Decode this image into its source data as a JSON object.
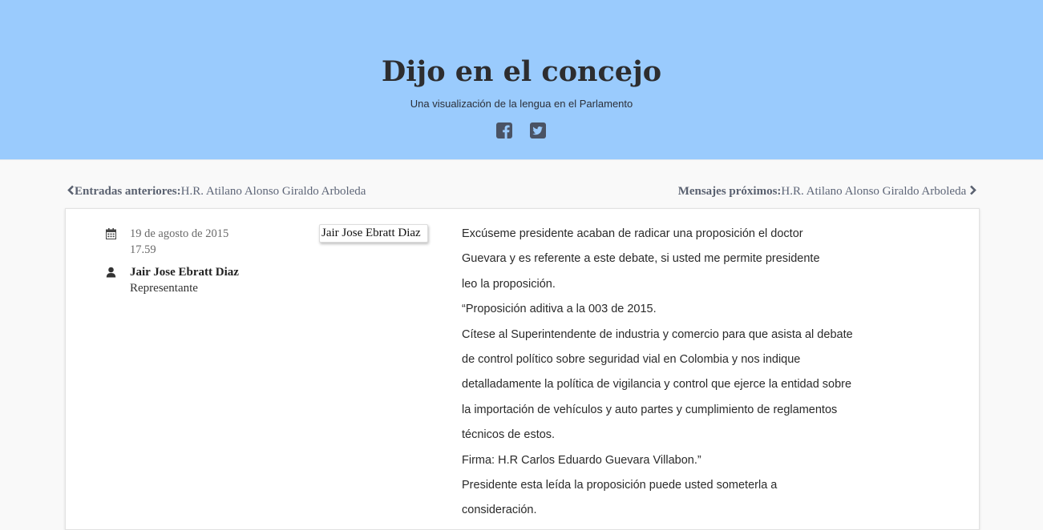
{
  "header": {
    "title": "Dijo en el concejo",
    "subtitle": "Una visualización de la lengua en el Parlamento",
    "social": [
      {
        "icon": "facebook-icon"
      },
      {
        "icon": "twitter-icon"
      }
    ]
  },
  "nav": {
    "prev_label": "Entradas anteriores:",
    "prev_name": "H.R. Atilano Alonso Giraldo Arboleda",
    "next_label": "Mensajes próximos:",
    "next_name": "H.R. Atilano Alonso Giraldo Arboleda"
  },
  "entry": {
    "date": "19 de agosto de 2015",
    "time": "17.59",
    "speaker_name": "Jair Jose Ebratt Diaz",
    "speaker_role": "Representante",
    "speaker_tag": "Jair Jose Ebratt Diaz",
    "lines": [
      "Excúseme presidente acaban de radicar una proposición el doctor",
      "Guevara y es referente a este debate, si usted me permite presidente",
      "leo la proposición.",
      "“Proposición aditiva a la 003 de 2015.",
      "Cítese al Superintendente de industria y comercio para que asista al debate",
      "de control político sobre seguridad vial en Colombia y nos indique",
      "detalladamente la política de vigilancia y control que ejerce la entidad sobre",
      "la importación de vehículos y auto partes y cumplimiento de reglamentos",
      "técnicos de estos.",
      "Firma: H.R Carlos Eduardo Guevara Villabon.”",
      "Presidente esta leída la proposición puede usted someterla a",
      "consideración."
    ]
  },
  "colors": {
    "header_bg": "#9acbfd",
    "page_bg": "#f9f9f9",
    "icon_color": "#4a5364"
  }
}
